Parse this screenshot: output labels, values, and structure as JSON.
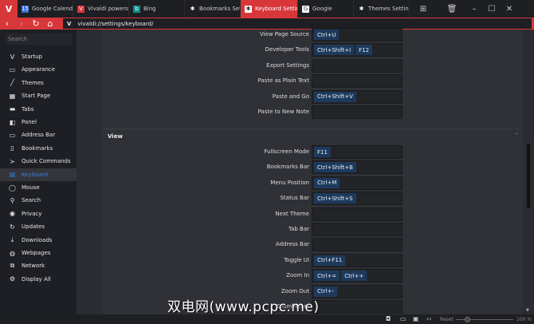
{
  "tabs": [
    {
      "label": "Google Calendar -",
      "icon": "calendar-icon",
      "color": "#3b6fd4",
      "glyph": "15"
    },
    {
      "label": "Vivaldi powers up",
      "icon": "vivaldi-icon",
      "color": "#d8373a",
      "glyph": "V"
    },
    {
      "label": "Bing",
      "icon": "bing-icon",
      "color": "#0f8f8f",
      "glyph": "b"
    },
    {
      "label": "Bookmarks Settings",
      "icon": "gear-icon",
      "color": "transparent",
      "glyph": "✱"
    },
    {
      "label": "Keyboard Settings",
      "icon": "gear-icon",
      "color": "#fff",
      "glyph": "✱",
      "active": true
    },
    {
      "label": "Google",
      "icon": "google-icon",
      "color": "#fff",
      "glyph": "G"
    },
    {
      "label": "Themes Settings",
      "icon": "gear-icon",
      "color": "transparent",
      "glyph": "✱"
    }
  ],
  "address": {
    "url": "vivaldi://settings/keyboard/"
  },
  "sidebar": {
    "search_placeholder": "Search",
    "items": [
      {
        "label": "Startup",
        "icon": "vivaldi-icon",
        "glyph": "V"
      },
      {
        "label": "Appearance",
        "icon": "window-icon",
        "glyph": "▭"
      },
      {
        "label": "Themes",
        "icon": "brush-icon",
        "glyph": "╱"
      },
      {
        "label": "Start Page",
        "icon": "grid-icon",
        "glyph": "▦"
      },
      {
        "label": "Tabs",
        "icon": "tabs-icon",
        "glyph": "▬"
      },
      {
        "label": "Panel",
        "icon": "panel-icon",
        "glyph": "◧"
      },
      {
        "label": "Address Bar",
        "icon": "address-bar-icon",
        "glyph": "▭"
      },
      {
        "label": "Bookmarks",
        "icon": "bookmark-icon",
        "glyph": "▯"
      },
      {
        "label": "Quick Commands",
        "icon": "command-icon",
        "glyph": "≻"
      },
      {
        "label": "Keyboard",
        "icon": "keyboard-icon",
        "glyph": "▤",
        "selected": true
      },
      {
        "label": "Mouse",
        "icon": "mouse-icon",
        "glyph": "◯"
      },
      {
        "label": "Search",
        "icon": "search-icon",
        "glyph": "⚲"
      },
      {
        "label": "Privacy",
        "icon": "eye-icon",
        "glyph": "◉"
      },
      {
        "label": "Updates",
        "icon": "refresh-icon",
        "glyph": "↻"
      },
      {
        "label": "Downloads",
        "icon": "download-icon",
        "glyph": "⤓"
      },
      {
        "label": "Webpages",
        "icon": "globe-icon",
        "glyph": "◍"
      },
      {
        "label": "Network",
        "icon": "network-icon",
        "glyph": "⧉"
      },
      {
        "label": "Display All",
        "icon": "gear-icon",
        "glyph": "⚙"
      }
    ]
  },
  "main": {
    "rows_before": [
      {
        "label": "View Page Source",
        "keys": [
          "Ctrl+U"
        ]
      },
      {
        "label": "Developer Tools",
        "keys": [
          "Ctrl+Shift+I",
          "F12"
        ]
      },
      {
        "label": "Export Settings",
        "keys": []
      },
      {
        "label": "Paste as Plain Text",
        "keys": []
      },
      {
        "label": "Paste and Go",
        "keys": [
          "Ctrl+Shift+V"
        ]
      },
      {
        "label": "Paste to New Note",
        "keys": []
      }
    ],
    "section_title": "View",
    "rows": [
      {
        "label": "Fullscreen Mode",
        "keys": [
          "F11"
        ]
      },
      {
        "label": "Bookmarks Bar",
        "keys": [
          "Ctrl+Shift+B"
        ]
      },
      {
        "label": "Menu Position",
        "keys": [
          "Ctrl+M"
        ]
      },
      {
        "label": "Status Bar",
        "keys": [
          "Ctrl+Shift+S"
        ]
      },
      {
        "label": "Next Theme",
        "keys": []
      },
      {
        "label": "Tab Bar",
        "keys": []
      },
      {
        "label": "Address Bar",
        "keys": []
      },
      {
        "label": "Toggle UI",
        "keys": [
          "Ctrl+F11"
        ]
      },
      {
        "label": "Zoom In",
        "keys": [
          "Ctrl+=",
          "Ctrl++"
        ]
      },
      {
        "label": "Zoom Out",
        "keys": [
          "Ctrl+-"
        ]
      },
      {
        "label": "Zoom Reset",
        "keys": []
      }
    ]
  },
  "status": {
    "reset_label": "Reset",
    "zoom_level": "100 %",
    "zoom_fraction": 0.2
  },
  "watermark": "双电网(www.pcpc.me)"
}
